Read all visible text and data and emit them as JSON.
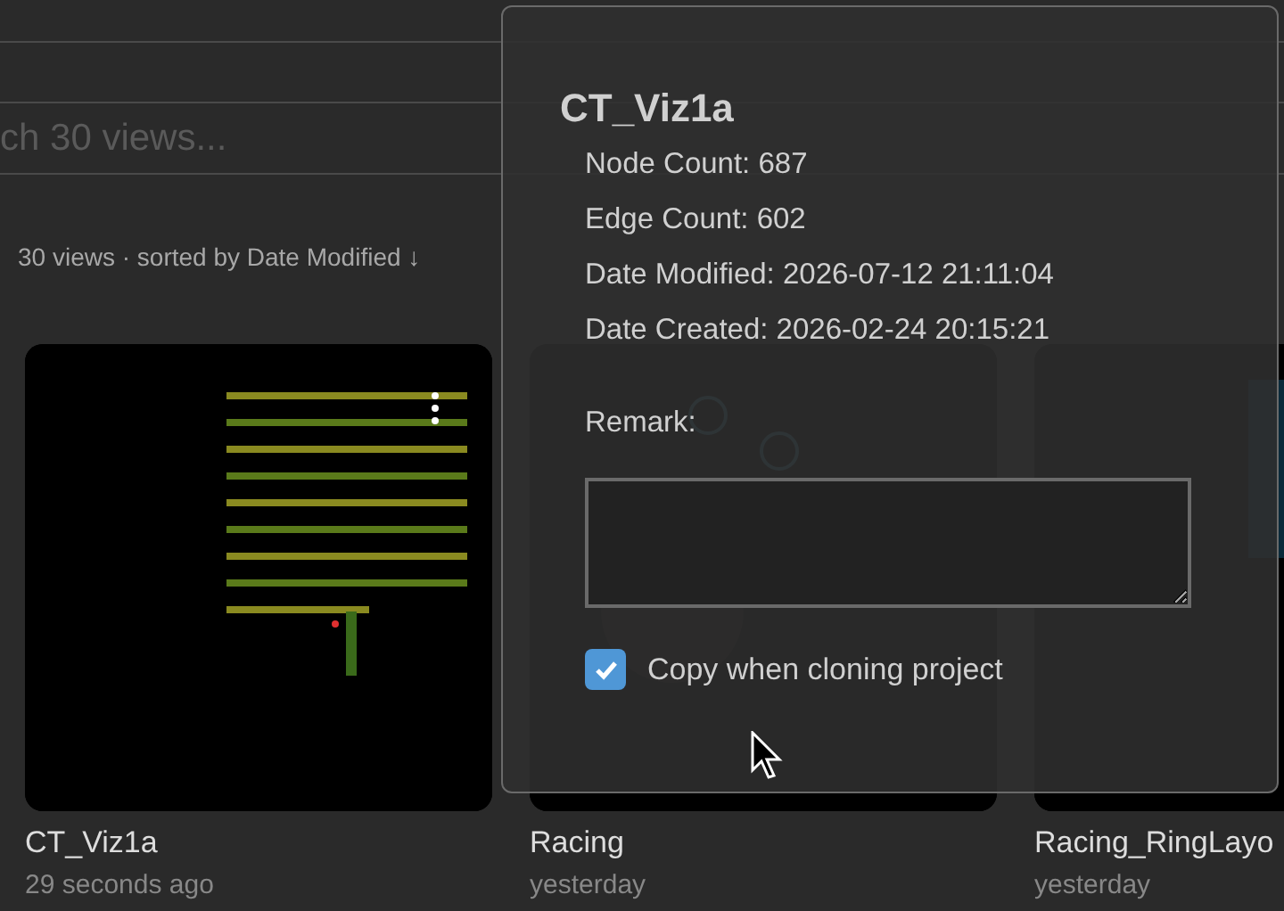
{
  "search": {
    "placeholder": "ch 30 views..."
  },
  "summary": "30 views · sorted by Date Modified ↓",
  "views": [
    {
      "title": "CT_Viz1a",
      "modified": "29 seconds ago",
      "menu": true
    },
    {
      "title": "Racing",
      "modified": "yesterday",
      "menu": false
    },
    {
      "title": "Racing_RingLayo",
      "modified": "yesterday",
      "menu": false
    }
  ],
  "popover": {
    "title": "CT_Viz1a",
    "details": [
      "Node Count: 687",
      "Edge Count: 602",
      "Date Modified: 2026-07-12 21:11:04",
      "Date Created: 2026-02-24 20:15:21"
    ],
    "remark_label": "Remark:",
    "copy_option": {
      "label": "Copy when cloning project",
      "checked": true
    }
  }
}
